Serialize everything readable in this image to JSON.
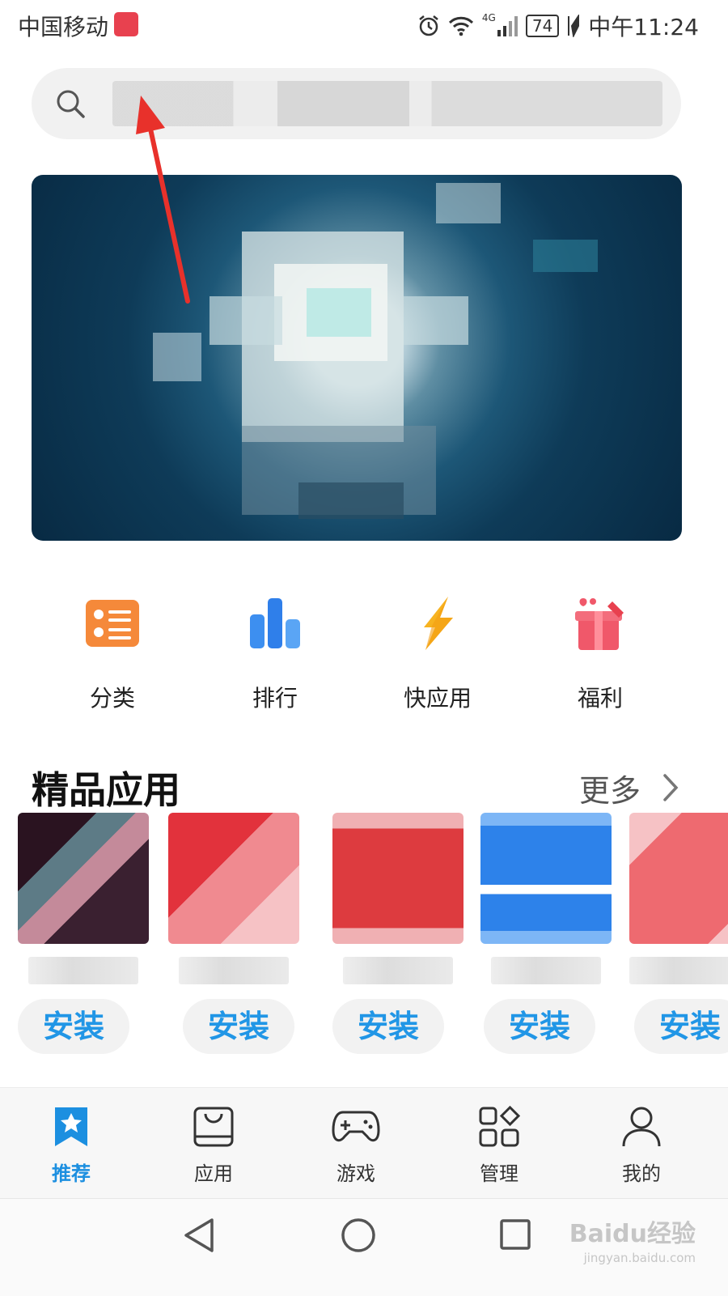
{
  "status_bar": {
    "carrier": "中国移动",
    "network": "4G",
    "battery": "74",
    "time": "中午11:24"
  },
  "search": {
    "placeholder": ""
  },
  "quick_entries": [
    {
      "label": "分类",
      "icon": "category-list-icon"
    },
    {
      "label": "排行",
      "icon": "ranking-bars-icon"
    },
    {
      "label": "快应用",
      "icon": "lightning-icon"
    },
    {
      "label": "福利",
      "icon": "gift-icon"
    }
  ],
  "section": {
    "title": "精品应用",
    "more_label": "更多"
  },
  "apps": [
    {
      "install_label": "安装",
      "thumb_color": "#3a2030"
    },
    {
      "install_label": "安装",
      "thumb_color": "#e94e58"
    },
    {
      "install_label": "安装",
      "thumb_color": "#dd3b3f"
    },
    {
      "install_label": "安装",
      "thumb_color": "#2d82ea"
    },
    {
      "install_label": "安装",
      "thumb_color": "#ee6a70"
    }
  ],
  "bottom_nav": [
    {
      "label": "推荐",
      "icon": "star-bookmark-icon",
      "active": true
    },
    {
      "label": "应用",
      "icon": "shopping-bag-icon",
      "active": false
    },
    {
      "label": "游戏",
      "icon": "gamepad-icon",
      "active": false
    },
    {
      "label": "管理",
      "icon": "apps-grid-icon",
      "active": false
    },
    {
      "label": "我的",
      "icon": "person-icon",
      "active": false
    }
  ],
  "watermark": {
    "brand": "Baidu经验",
    "url": "jingyan.baidu.com"
  },
  "colors": {
    "accent": "#1c8fe0",
    "install_text": "#2196e6",
    "annotation_arrow": "#e8312b"
  }
}
